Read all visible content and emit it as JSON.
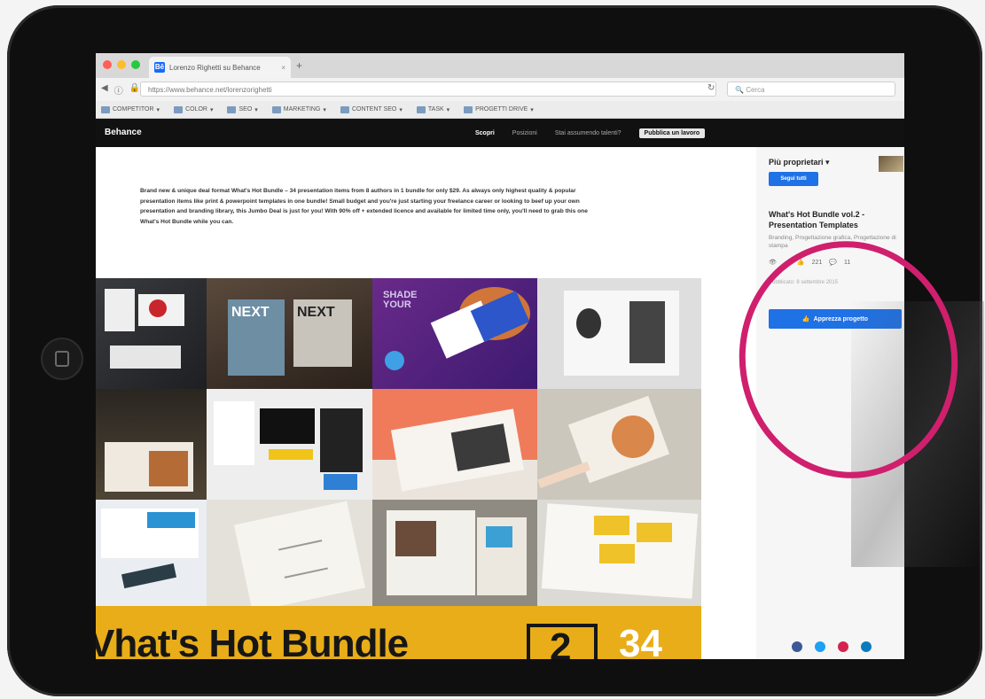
{
  "browser": {
    "tab_title": "Lorenzo Righetti su Behance",
    "tab_close": "×",
    "new_tab": "+",
    "url": "https://www.behance.net/lorenzorighetti",
    "search_placeholder": "Cerca",
    "bookmarks": [
      "COMPETITOR",
      "COLOR",
      "SEO",
      "MARKETING",
      "CONTENT SEO",
      "TASK",
      "PROGETTI DRIVE"
    ]
  },
  "behance_nav": {
    "brand": "Behance",
    "links": [
      "Scopri",
      "Posizioni"
    ],
    "question": "Stai assumendo talenti?",
    "publish_label": "Pubblica un lavoro"
  },
  "project": {
    "description": "Brand new & unique deal format What's Hot Bundle – 34 presentation items from 8 authors in 1 bundle for only $29. As always only highest quality & popular presentation items like print & powerpoint templates in one bundle! Small budget and you're just starting your freelance career or looking to beef up your own presentation and branding library, this Jumbo Deal is just for you! With 90% off + extended licence and available for limited time only, you'll need to grab this one What's Hot Bundle while you can.",
    "tiles": [
      {
        "text": ""
      },
      {
        "text": "NEXT"
      },
      {
        "text": "SHADE YOUR"
      },
      {
        "text": ""
      },
      {
        "text": ""
      },
      {
        "text": ""
      },
      {
        "text": ""
      },
      {
        "text": ""
      },
      {
        "text": ""
      },
      {
        "text": ""
      },
      {
        "text": ""
      },
      {
        "text": ""
      }
    ],
    "banner_title": "Vhat's Hot Bundle",
    "banner_box": "2",
    "banner_number": "34"
  },
  "sidebar": {
    "owners_label": "Più proprietari",
    "owners_chevron": "▾",
    "follow_label": "Segui tutti",
    "title": "What's Hot Bundle vol.2 - Presentation Templates",
    "fields": "Branding, Progettazione grafica, Progettazione di stampa",
    "stats": {
      "views": "…",
      "likes": "221",
      "comments": "11"
    },
    "published": "Pubblicato: 8 settembre 2015",
    "appreciate_label": "Apprezza progetto",
    "social": [
      "facebook",
      "twitter",
      "pinterest",
      "linkedin"
    ]
  },
  "colors": {
    "behance_blue": "#1f71e6",
    "highlight_circle": "#cf1f6d",
    "banner_yellow": "#e8ad18",
    "nav_black": "#111111"
  }
}
